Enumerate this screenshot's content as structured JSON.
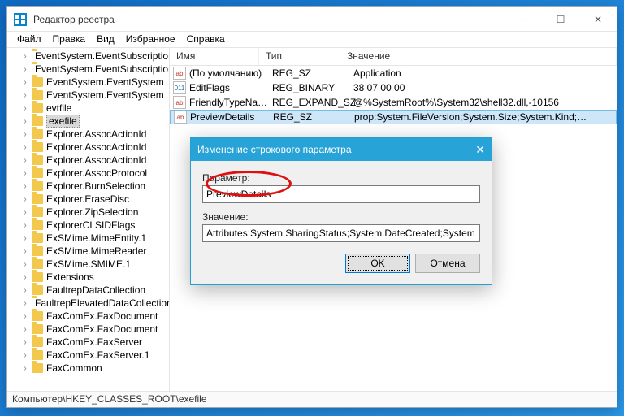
{
  "window": {
    "title": "Редактор реестра"
  },
  "menubar": [
    "Файл",
    "Правка",
    "Вид",
    "Избранное",
    "Справка"
  ],
  "tree": {
    "selected_index": 5,
    "items": [
      "EventSystem.EventSubscription",
      "EventSystem.EventSubscription",
      "EventSystem.EventSystem",
      "EventSystem.EventSystem",
      "evtfile",
      "exefile",
      "Explorer.AssocActionId",
      "Explorer.AssocActionId",
      "Explorer.AssocActionId",
      "Explorer.AssocProtocol",
      "Explorer.BurnSelection",
      "Explorer.EraseDisc",
      "Explorer.ZipSelection",
      "ExplorerCLSIDFlags",
      "ExSMime.MimeEntity.1",
      "ExSMime.MimeReader",
      "ExSMime.SMIME.1",
      "Extensions",
      "FaultrepDataCollection",
      "FaultrepElevatedDataCollection",
      "FaxComEx.FaxDocument",
      "FaxComEx.FaxDocument",
      "FaxComEx.FaxServer",
      "FaxComEx.FaxServer.1",
      "FaxCommon"
    ]
  },
  "columns": {
    "name": "Имя",
    "type": "Тип",
    "value": "Значение"
  },
  "values": [
    {
      "icon": "sz",
      "name": "(По умолчанию)",
      "type": "REG_SZ",
      "value": "Application"
    },
    {
      "icon": "bin",
      "name": "EditFlags",
      "type": "REG_BINARY",
      "value": "38 07 00 00"
    },
    {
      "icon": "sz",
      "name": "FriendlyTypeNam…",
      "type": "REG_EXPAND_SZ",
      "value": "@%SystemRoot%\\System32\\shell32.dll,-10156"
    },
    {
      "icon": "sz",
      "name": "PreviewDetails",
      "type": "REG_SZ",
      "value": "prop:System.FileVersion;System.Size;System.Kind;…",
      "selected": true
    }
  ],
  "statusbar": "Компьютер\\HKEY_CLASSES_ROOT\\exefile",
  "dialog": {
    "title": "Изменение строкового параметра",
    "param_label": "Параметр:",
    "param_value": "PreviewDetails",
    "value_label": "Значение:",
    "value_value": "Attributes;System.SharingStatus;System.DateCreated;System.DateModified",
    "ok": "OK",
    "cancel": "Отмена"
  }
}
